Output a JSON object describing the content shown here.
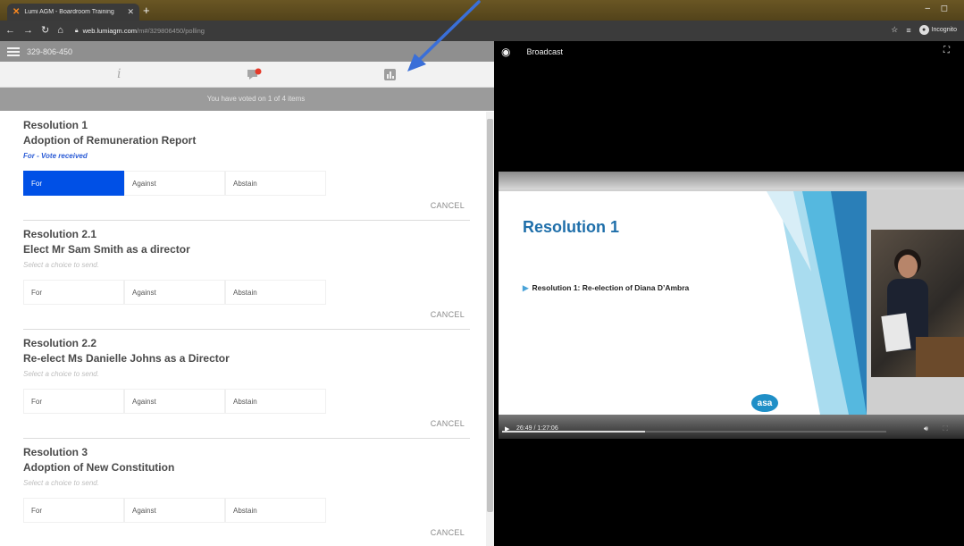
{
  "browser": {
    "tab_title": "Lumi AGM - Boardroom Training",
    "url_host": "web.lumiagm.com",
    "url_path": "/m#/329806450/polling",
    "incognito_label": "Incognito"
  },
  "app": {
    "meeting_id": "329-806-450",
    "voted_status": "You have voted on 1 of 4 items",
    "cancel_label": "CANCEL",
    "choice_labels": [
      "For",
      "Against",
      "Abstain"
    ],
    "resolutions": [
      {
        "number": "Resolution 1",
        "title": "Adoption of Remuneration Report",
        "status": "For - Vote received",
        "selected": "For"
      },
      {
        "number": "Resolution 2.1",
        "title": "Elect Mr Sam Smith as a director",
        "status": "Select a choice to send.",
        "selected": ""
      },
      {
        "number": "Resolution 2.2",
        "title": "Re-elect Ms Danielle Johns as a Director",
        "status": "Select a choice to send.",
        "selected": ""
      },
      {
        "number": "Resolution 3",
        "title": "Adoption of New Constitution",
        "status": "Select a choice to send.",
        "selected": ""
      }
    ]
  },
  "broadcast": {
    "title": "Broadcast",
    "slide_title": "Resolution 1",
    "slide_bullet": "Resolution 1: Re-election of Diana D’Ambra",
    "logo_text": "asa",
    "time": "26:49 / 1:27:06",
    "progress_fraction": 0.372
  },
  "colors": {
    "selected_choice": "#0050e6",
    "vote_received": "#2b5cd6",
    "slide_title": "#1f6faa",
    "annotation_arrow": "#3a6fd8"
  }
}
